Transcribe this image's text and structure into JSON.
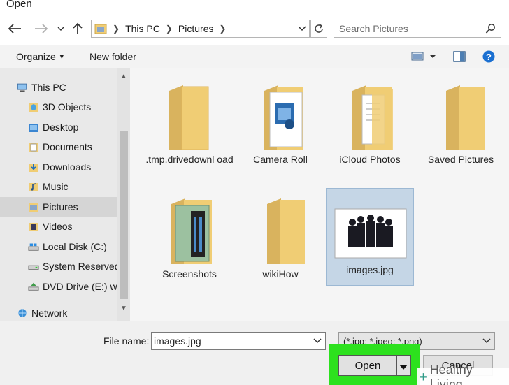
{
  "window": {
    "title": "Open"
  },
  "nav": {
    "breadcrumb": [
      "This PC",
      "Pictures"
    ],
    "search_placeholder": "Search Pictures"
  },
  "toolbar": {
    "organize_label": "Organize",
    "new_folder_label": "New folder",
    "help_label": "?"
  },
  "sidebar": {
    "items": [
      {
        "label": "This PC",
        "icon": "pc-icon"
      },
      {
        "label": "3D Objects",
        "icon": "folder-3d-icon"
      },
      {
        "label": "Desktop",
        "icon": "desktop-folder-icon"
      },
      {
        "label": "Documents",
        "icon": "documents-folder-icon"
      },
      {
        "label": "Downloads",
        "icon": "downloads-folder-icon"
      },
      {
        "label": "Music",
        "icon": "music-folder-icon"
      },
      {
        "label": "Pictures",
        "icon": "pictures-folder-icon"
      },
      {
        "label": "Videos",
        "icon": "videos-folder-icon"
      },
      {
        "label": "Local Disk (C:)",
        "icon": "local-disk-icon"
      },
      {
        "label": "System Reserved",
        "icon": "drive-icon"
      },
      {
        "label": "DVD Drive (E:) w",
        "icon": "dvd-drive-icon"
      },
      {
        "label": "Network",
        "icon": "network-icon"
      }
    ],
    "selected": "Pictures"
  },
  "files": [
    {
      "label": ".tmp.drivedownl oad",
      "kind": "folder"
    },
    {
      "label": "Camera Roll",
      "kind": "folder-media"
    },
    {
      "label": "iCloud Photos",
      "kind": "folder-docs"
    },
    {
      "label": "Saved Pictures",
      "kind": "folder"
    },
    {
      "label": "Screenshots",
      "kind": "folder-screens"
    },
    {
      "label": "wikiHow",
      "kind": "folder"
    },
    {
      "label": "images.jpg",
      "kind": "image",
      "selected": true
    }
  ],
  "bottom": {
    "filename_label": "File name:",
    "filename_value": "images.jpg",
    "filetype_value": "(*.jpg; *.jpeg; *.png)",
    "open_label": "Open",
    "cancel_label": "Cancel"
  },
  "watermark": {
    "text": "Healthy Living"
  },
  "colors": {
    "highlight": "#2de11e",
    "folder": "#f0cd74",
    "selection": "#c5d6e6",
    "help_icon": "#1a6fd1"
  }
}
